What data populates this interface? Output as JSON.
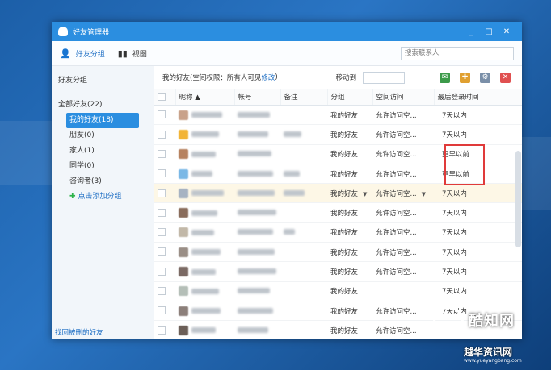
{
  "window": {
    "title": "好友管理器",
    "controls": [
      "_",
      "□",
      "✕"
    ]
  },
  "toolbar": {
    "tab_friend_group": "好友分组",
    "tab_view": "视图",
    "search_placeholder": "搜索联系人"
  },
  "sidebar": {
    "title": "好友分组",
    "all_friends": "全部好友(22)",
    "groups": [
      {
        "label": "我的好友(18)",
        "active": true
      },
      {
        "label": "朋友(0)",
        "active": false
      },
      {
        "label": "家人(1)",
        "active": false
      },
      {
        "label": "同学(0)",
        "active": false
      },
      {
        "label": "咨询者(3)",
        "active": false
      }
    ],
    "add_group": "点击添加分组",
    "recover": "找回被删的好友"
  },
  "infobar": {
    "perm_text": "我的好友(空间权限：所有人可见",
    "perm_link": "修改",
    "perm_close": ")",
    "move_to": "移动到"
  },
  "table": {
    "headers": [
      "昵称 ▲",
      "帐号",
      "备注",
      "分组",
      "空间访问",
      "最后登录时间"
    ],
    "rows": [
      {
        "group": "我的好友",
        "access": "允许访问空...",
        "last": "7天以内",
        "hl": false
      },
      {
        "group": "我的好友",
        "access": "允许访问空...",
        "last": "7天以内",
        "hl": false
      },
      {
        "group": "我的好友",
        "access": "允许访问空...",
        "last": "更早以前",
        "hl": false
      },
      {
        "group": "我的好友",
        "access": "允许访问空...",
        "last": "更早以前",
        "hl": false
      },
      {
        "group": "我的好友",
        "access": "允许访问空...",
        "last": "7天以内",
        "hl": true
      },
      {
        "group": "我的好友",
        "access": "允许访问空...",
        "last": "7天以内",
        "hl": false
      },
      {
        "group": "我的好友",
        "access": "允许访问空...",
        "last": "7天以内",
        "hl": false
      },
      {
        "group": "我的好友",
        "access": "允许访问空...",
        "last": "7天以内",
        "hl": false
      },
      {
        "group": "我的好友",
        "access": "允许访问空...",
        "last": "7天以内",
        "hl": false
      },
      {
        "group": "我的好友",
        "access": "",
        "last": "7天以内",
        "hl": false
      },
      {
        "group": "我的好友",
        "access": "允许访问空...",
        "last": "7天以内",
        "hl": false
      },
      {
        "group": "我的好友",
        "access": "允许访问空...",
        "last": "",
        "hl": false
      }
    ]
  },
  "watermark": {
    "brand": "酷知网",
    "site": "越华资讯网",
    "url": "www.yueyangbang.com"
  },
  "colors": {
    "accent": "#2b8ee0",
    "highlight_box": "#e03a3a",
    "selected_row": "#fdf7e6"
  }
}
